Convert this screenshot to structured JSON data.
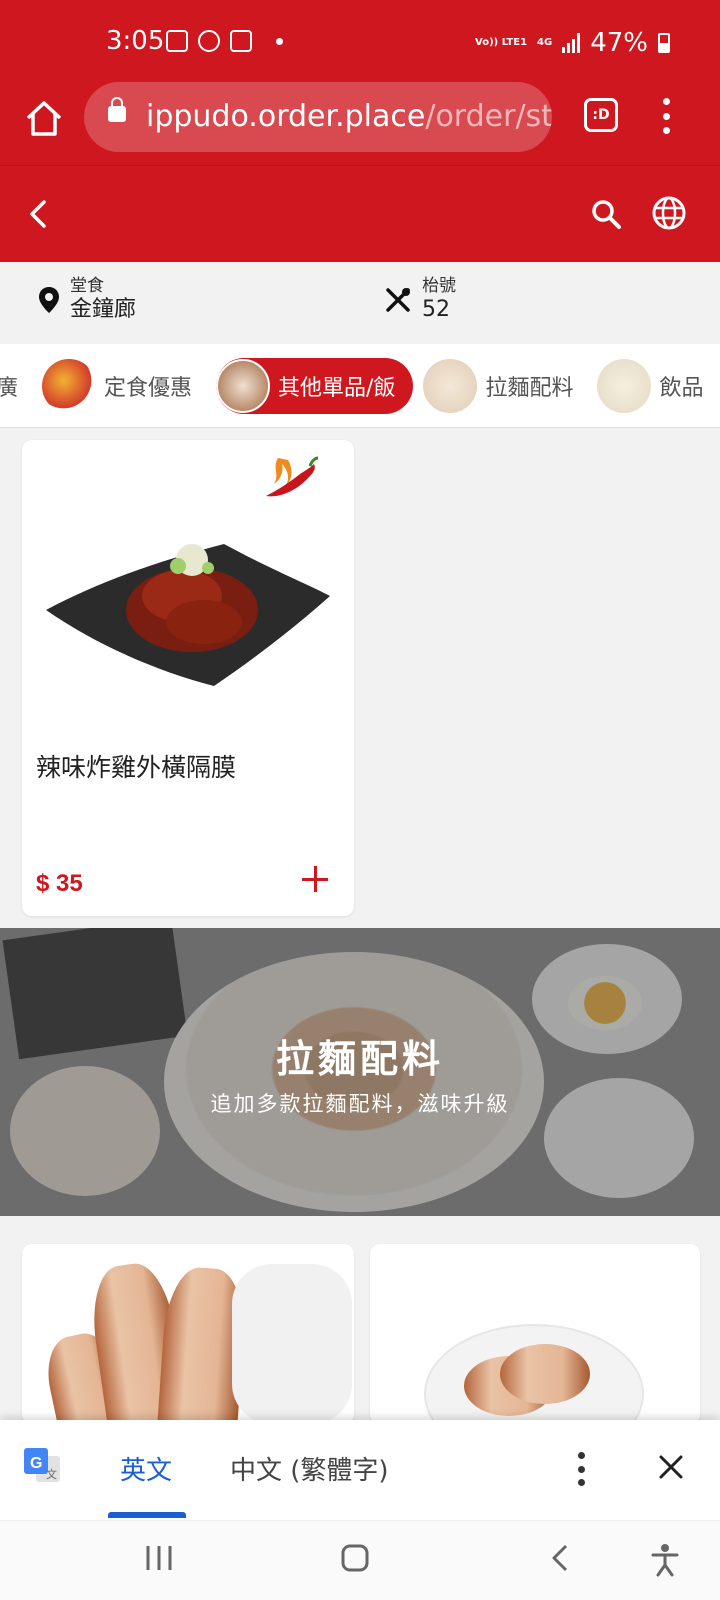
{
  "status_bar": {
    "time": "3:05",
    "network_label": "Vo)) LTE1",
    "data_label": "4G",
    "battery": "47%"
  },
  "browser": {
    "url_host": "ippudo.order.place",
    "url_path": "/order/stc",
    "tabs_label": ":D"
  },
  "info": {
    "dining_label": "堂食",
    "location": "金鐘廊",
    "table_label": "枱號",
    "table_number": "52"
  },
  "categories": [
    {
      "label": "推廣"
    },
    {
      "label": "定食優惠"
    },
    {
      "label": "其他單品/飯",
      "active": true
    },
    {
      "label": "拉麵配料"
    },
    {
      "label": "飲品"
    }
  ],
  "product": {
    "name": "辣味炸雞外橫隔膜",
    "price": "$ 35"
  },
  "section": {
    "title": "拉麵配料",
    "subtitle": "追加多款拉麵配料，滋味升級"
  },
  "translate_bar": {
    "lang_source": "英文",
    "lang_target": "中文 (繁體字)"
  },
  "colors": {
    "brand_red": "#cf171f",
    "translate_blue": "#1a5fd0"
  }
}
